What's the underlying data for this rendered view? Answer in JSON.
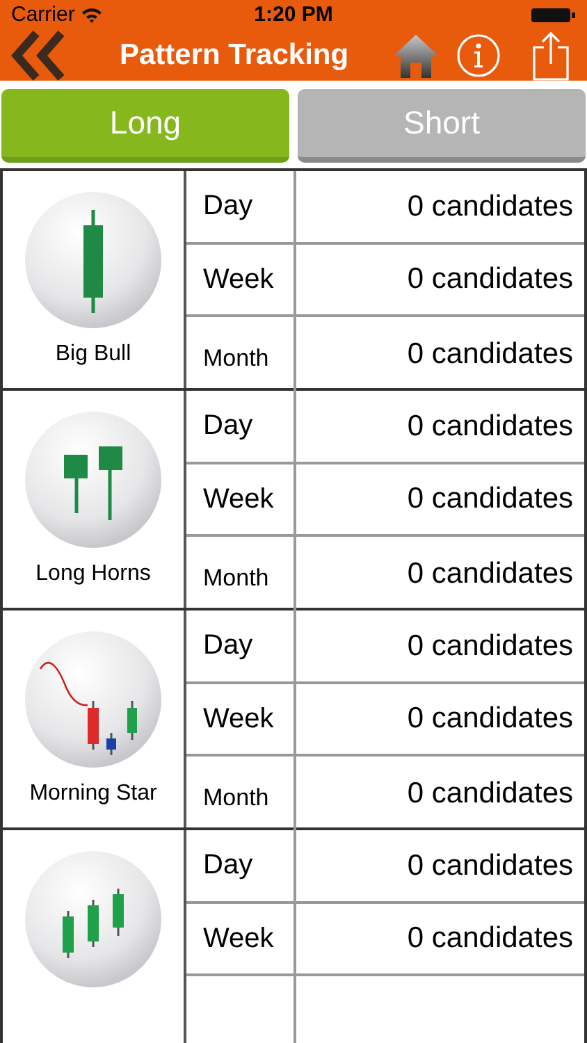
{
  "status_bar": {
    "carrier": "Carrier",
    "time": "1:20 PM"
  },
  "nav": {
    "title": "Pattern Tracking"
  },
  "tabs": [
    {
      "label": "Long",
      "selected": true
    },
    {
      "label": "Short",
      "selected": false
    }
  ],
  "patterns": [
    {
      "name": "Big Bull",
      "kind": "big-bull",
      "rows": [
        {
          "period": "Day",
          "count": "0 candidates"
        },
        {
          "period": "Week",
          "count": "0 candidates"
        },
        {
          "period": "Month",
          "count": "0 candidates"
        }
      ]
    },
    {
      "name": "Long Horns",
      "kind": "long-horns",
      "rows": [
        {
          "period": "Day",
          "count": "0 candidates"
        },
        {
          "period": "Week",
          "count": "0 candidates"
        },
        {
          "period": "Month",
          "count": "0 candidates"
        }
      ]
    },
    {
      "name": "Morning Star",
      "kind": "morning-star",
      "rows": [
        {
          "period": "Day",
          "count": "0 candidates"
        },
        {
          "period": "Week",
          "count": "0 candidates"
        },
        {
          "period": "Month",
          "count": "0 candidates"
        }
      ]
    },
    {
      "kind": "three-bull",
      "rows": [
        {
          "period": "Day",
          "count": "0 candidates"
        },
        {
          "period": "Week",
          "count": "0 candidates"
        }
      ]
    }
  ]
}
